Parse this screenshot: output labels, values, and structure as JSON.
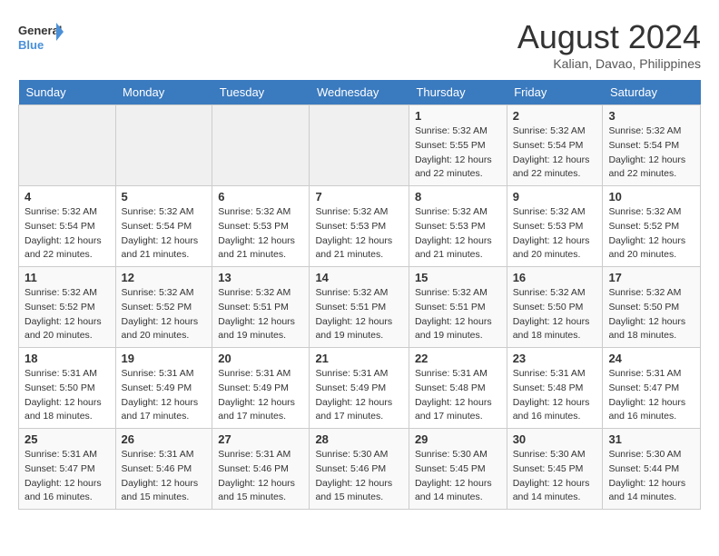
{
  "header": {
    "logo_line1": "General",
    "logo_line2": "Blue",
    "month_year": "August 2024",
    "location": "Kalian, Davao, Philippines"
  },
  "weekdays": [
    "Sunday",
    "Monday",
    "Tuesday",
    "Wednesday",
    "Thursday",
    "Friday",
    "Saturday"
  ],
  "weeks": [
    [
      {
        "day": "",
        "info": ""
      },
      {
        "day": "",
        "info": ""
      },
      {
        "day": "",
        "info": ""
      },
      {
        "day": "",
        "info": ""
      },
      {
        "day": "1",
        "sunrise": "5:32 AM",
        "sunset": "5:55 PM",
        "daylight": "12 hours and 22 minutes."
      },
      {
        "day": "2",
        "sunrise": "5:32 AM",
        "sunset": "5:54 PM",
        "daylight": "12 hours and 22 minutes."
      },
      {
        "day": "3",
        "sunrise": "5:32 AM",
        "sunset": "5:54 PM",
        "daylight": "12 hours and 22 minutes."
      }
    ],
    [
      {
        "day": "4",
        "sunrise": "5:32 AM",
        "sunset": "5:54 PM",
        "daylight": "12 hours and 22 minutes."
      },
      {
        "day": "5",
        "sunrise": "5:32 AM",
        "sunset": "5:54 PM",
        "daylight": "12 hours and 21 minutes."
      },
      {
        "day": "6",
        "sunrise": "5:32 AM",
        "sunset": "5:53 PM",
        "daylight": "12 hours and 21 minutes."
      },
      {
        "day": "7",
        "sunrise": "5:32 AM",
        "sunset": "5:53 PM",
        "daylight": "12 hours and 21 minutes."
      },
      {
        "day": "8",
        "sunrise": "5:32 AM",
        "sunset": "5:53 PM",
        "daylight": "12 hours and 21 minutes."
      },
      {
        "day": "9",
        "sunrise": "5:32 AM",
        "sunset": "5:53 PM",
        "daylight": "12 hours and 20 minutes."
      },
      {
        "day": "10",
        "sunrise": "5:32 AM",
        "sunset": "5:52 PM",
        "daylight": "12 hours and 20 minutes."
      }
    ],
    [
      {
        "day": "11",
        "sunrise": "5:32 AM",
        "sunset": "5:52 PM",
        "daylight": "12 hours and 20 minutes."
      },
      {
        "day": "12",
        "sunrise": "5:32 AM",
        "sunset": "5:52 PM",
        "daylight": "12 hours and 20 minutes."
      },
      {
        "day": "13",
        "sunrise": "5:32 AM",
        "sunset": "5:51 PM",
        "daylight": "12 hours and 19 minutes."
      },
      {
        "day": "14",
        "sunrise": "5:32 AM",
        "sunset": "5:51 PM",
        "daylight": "12 hours and 19 minutes."
      },
      {
        "day": "15",
        "sunrise": "5:32 AM",
        "sunset": "5:51 PM",
        "daylight": "12 hours and 19 minutes."
      },
      {
        "day": "16",
        "sunrise": "5:32 AM",
        "sunset": "5:50 PM",
        "daylight": "12 hours and 18 minutes."
      },
      {
        "day": "17",
        "sunrise": "5:32 AM",
        "sunset": "5:50 PM",
        "daylight": "12 hours and 18 minutes."
      }
    ],
    [
      {
        "day": "18",
        "sunrise": "5:31 AM",
        "sunset": "5:50 PM",
        "daylight": "12 hours and 18 minutes."
      },
      {
        "day": "19",
        "sunrise": "5:31 AM",
        "sunset": "5:49 PM",
        "daylight": "12 hours and 17 minutes."
      },
      {
        "day": "20",
        "sunrise": "5:31 AM",
        "sunset": "5:49 PM",
        "daylight": "12 hours and 17 minutes."
      },
      {
        "day": "21",
        "sunrise": "5:31 AM",
        "sunset": "5:49 PM",
        "daylight": "12 hours and 17 minutes."
      },
      {
        "day": "22",
        "sunrise": "5:31 AM",
        "sunset": "5:48 PM",
        "daylight": "12 hours and 17 minutes."
      },
      {
        "day": "23",
        "sunrise": "5:31 AM",
        "sunset": "5:48 PM",
        "daylight": "12 hours and 16 minutes."
      },
      {
        "day": "24",
        "sunrise": "5:31 AM",
        "sunset": "5:47 PM",
        "daylight": "12 hours and 16 minutes."
      }
    ],
    [
      {
        "day": "25",
        "sunrise": "5:31 AM",
        "sunset": "5:47 PM",
        "daylight": "12 hours and 16 minutes."
      },
      {
        "day": "26",
        "sunrise": "5:31 AM",
        "sunset": "5:46 PM",
        "daylight": "12 hours and 15 minutes."
      },
      {
        "day": "27",
        "sunrise": "5:31 AM",
        "sunset": "5:46 PM",
        "daylight": "12 hours and 15 minutes."
      },
      {
        "day": "28",
        "sunrise": "5:30 AM",
        "sunset": "5:46 PM",
        "daylight": "12 hours and 15 minutes."
      },
      {
        "day": "29",
        "sunrise": "5:30 AM",
        "sunset": "5:45 PM",
        "daylight": "12 hours and 14 minutes."
      },
      {
        "day": "30",
        "sunrise": "5:30 AM",
        "sunset": "5:45 PM",
        "daylight": "12 hours and 14 minutes."
      },
      {
        "day": "31",
        "sunrise": "5:30 AM",
        "sunset": "5:44 PM",
        "daylight": "12 hours and 14 minutes."
      }
    ]
  ]
}
